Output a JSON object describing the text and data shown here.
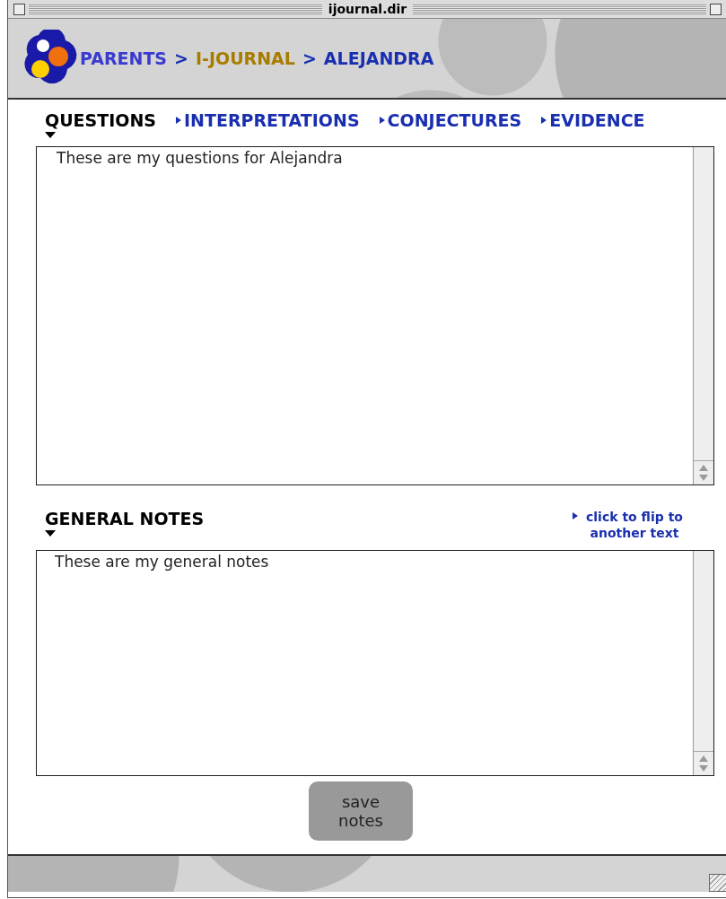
{
  "window": {
    "title": "ijournal.dir"
  },
  "breadcrumb": [
    {
      "label": "PARENTS",
      "color": "#3a3ad0"
    },
    {
      "label": ">",
      "color": "#1a2fb0"
    },
    {
      "label": "I-JOURNAL",
      "color": "#a87c00"
    },
    {
      "label": ">",
      "color": "#1a2fb0"
    },
    {
      "label": "ALEJANDRA",
      "color": "#1a2fb0"
    }
  ],
  "tabs": [
    {
      "label": "QUESTIONS",
      "selected": true
    },
    {
      "label": "INTERPRETATIONS",
      "selected": false
    },
    {
      "label": "CONJECTURES",
      "selected": false
    },
    {
      "label": "EVIDENCE",
      "selected": false
    }
  ],
  "questions_field": {
    "value": "These are my questions for Alejandra"
  },
  "general_notes": {
    "heading": "GENERAL NOTES",
    "flip_link": "click to flip to another text",
    "value": "These are my general notes"
  },
  "save_button": {
    "label": "save notes"
  }
}
